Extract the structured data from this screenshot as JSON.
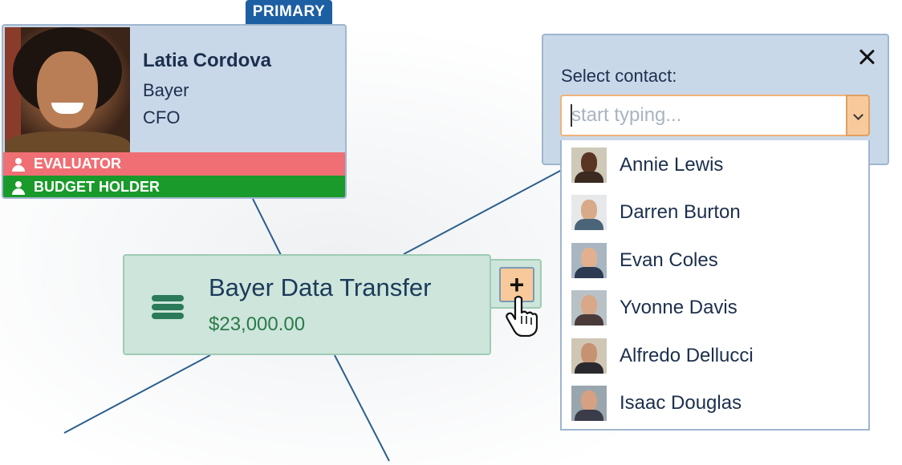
{
  "contact_card": {
    "badge": "PRIMARY",
    "name": "Latia Cordova",
    "company": "Bayer",
    "title": "CFO",
    "roles": [
      {
        "label": "EVALUATOR",
        "color": "#ef6f74"
      },
      {
        "label": "BUDGET HOLDER",
        "color": "#1a9a2a"
      }
    ]
  },
  "opportunity": {
    "title": "Bayer Data Transfer",
    "amount": "$23,000.00",
    "icon": "database-icon",
    "add_label": "+"
  },
  "select_contact": {
    "label": "Select contact:",
    "placeholder": "start typing...",
    "value": "",
    "options": [
      {
        "name": "Annie Lewis",
        "bg": "#cfc9b8",
        "skin": "#5a3524",
        "cloth": "#3a2a20"
      },
      {
        "name": "Darren Burton",
        "bg": "#e6e8ea",
        "skin": "#d9aa8a",
        "cloth": "#4a6478"
      },
      {
        "name": "Evan Coles",
        "bg": "#a9b6c2",
        "skin": "#e2b08e",
        "cloth": "#2c3a52"
      },
      {
        "name": "Yvonne Davis",
        "bg": "#b8c2c6",
        "skin": "#d8a888",
        "cloth": "#4a3a3a"
      },
      {
        "name": "Alfredo Dellucci",
        "bg": "#d0c6b4",
        "skin": "#c79272",
        "cloth": "#2a2a2e"
      },
      {
        "name": "Isaac Douglas",
        "bg": "#9aa6ae",
        "skin": "#d6a082",
        "cloth": "#3a3c4a"
      }
    ]
  },
  "colors": {
    "accent": "#1d5fa3",
    "evaluator": "#ef6f74",
    "budget_holder": "#1a9a2a",
    "opportunity_bg": "#cde5db",
    "card_bg": "#c9d8e8"
  }
}
